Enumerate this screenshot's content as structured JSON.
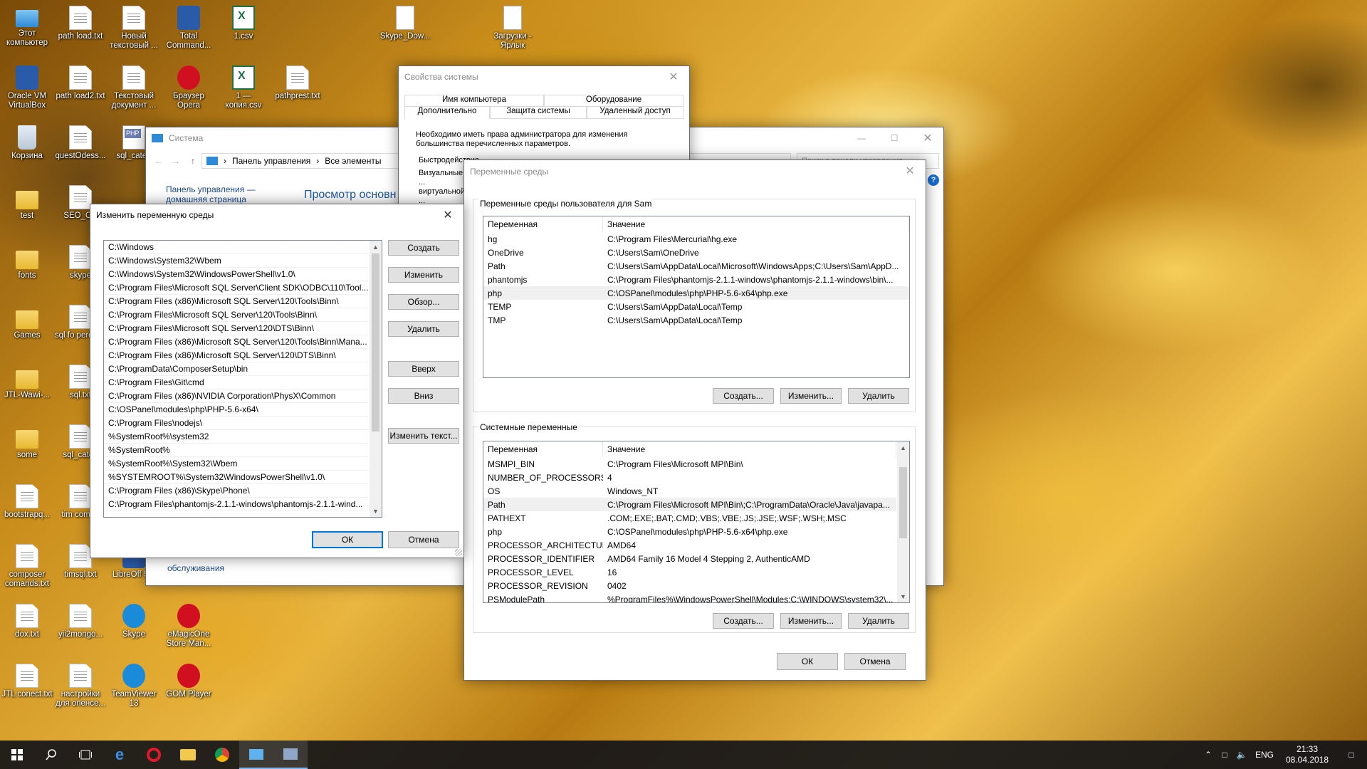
{
  "desktop": {
    "icons": [
      {
        "label": "Этот компьютер",
        "icon": "computer-icon"
      },
      {
        "label": "path load.txt",
        "icon": "text-file-icon"
      },
      {
        "label": "Новый текстовый ...",
        "icon": "text-file-icon"
      },
      {
        "label": "Total Command...",
        "icon": "total-commander-icon"
      },
      {
        "label": "1.csv",
        "icon": "csv-file-icon"
      },
      {
        "label": "Skype_Dow...",
        "icon": "shortcut-icon"
      },
      {
        "label": "Загрузки - Ярлык",
        "icon": "shortcut-icon"
      },
      {
        "label": "Oracle VM VirtualBox",
        "icon": "virtualbox-icon"
      },
      {
        "label": "path load2.txt",
        "icon": "text-file-icon"
      },
      {
        "label": "Текстовый документ ...",
        "icon": "text-file-icon"
      },
      {
        "label": "Браузер Opera",
        "icon": "opera-icon"
      },
      {
        "label": "1 — копия.csv",
        "icon": "csv-file-icon"
      },
      {
        "label": "pathprest.txt",
        "icon": "text-file-icon"
      },
      {
        "label": "Корзина",
        "icon": "recycle-bin-icon"
      },
      {
        "label": "questOdess...",
        "icon": "text-file-icon"
      },
      {
        "label": "sql_categ",
        "icon": "php-file-icon"
      },
      {
        "label": "test",
        "icon": "folder-icon"
      },
      {
        "label": "SEO_OP",
        "icon": "text-file-icon"
      },
      {
        "label": "fonts",
        "icon": "folder-icon"
      },
      {
        "label": "skype",
        "icon": "text-file-icon"
      },
      {
        "label": "Games",
        "icon": "folder-icon"
      },
      {
        "label": "sql fo perenos",
        "icon": "text-file-icon"
      },
      {
        "label": "JTL-Wawi-...",
        "icon": "folder-icon"
      },
      {
        "label": "sql.txt",
        "icon": "text-file-icon"
      },
      {
        "label": "some",
        "icon": "folder-icon"
      },
      {
        "label": "sql_categ",
        "icon": "text-file-icon"
      },
      {
        "label": "bootstrapq...",
        "icon": "text-file-icon"
      },
      {
        "label": "tim compo",
        "icon": "text-file-icon"
      },
      {
        "label": "composer comands.txt",
        "icon": "text-file-icon"
      },
      {
        "label": "timsql.txt",
        "icon": "text-file-icon"
      },
      {
        "label": "LibreOff 5.4",
        "icon": "libreoffice-icon"
      },
      {
        "label": "dox.txt",
        "icon": "text-file-icon"
      },
      {
        "label": "yii2mongo...",
        "icon": "text-file-icon"
      },
      {
        "label": "Skype",
        "icon": "skype-icon"
      },
      {
        "label": "eMagicOne Store Man...",
        "icon": "emagicone-icon"
      },
      {
        "label": "JTL conect.txt",
        "icon": "text-file-icon"
      },
      {
        "label": "настройки для опенсе...",
        "icon": "text-file-icon"
      },
      {
        "label": "TeamViewer 13",
        "icon": "teamviewer-icon"
      },
      {
        "label": "GOM Player",
        "icon": "gom-player-icon"
      }
    ]
  },
  "system_window": {
    "title": "Система",
    "breadcrumb": [
      "Панель управления",
      "Все элементы"
    ],
    "sidebar_link": "Панель управления — домашняя страница",
    "heading": "Просмотр основн",
    "footer_link": "обслуживания",
    "search_placeholder": "Поиск в панели управления"
  },
  "sysprops_window": {
    "title": "Свойства системы",
    "tabs_row1": [
      "Имя компьютера",
      "Оборудование"
    ],
    "tabs_row2": [
      "Дополнительно",
      "Защита системы",
      "Удаленный доступ"
    ],
    "admin_note": "Необходимо иметь права администратора для изменения большинства перечисленных параметров.",
    "perf_label": "Быстродействие",
    "perf_desc": "Визуальные ... виртуальной ..."
  },
  "env_window": {
    "title": "Переменные среды",
    "user_group_label": "Переменные среды пользователя для Sam",
    "columns": [
      "Переменная",
      "Значение"
    ],
    "user_vars": [
      {
        "name": "hg",
        "value": "C:\\Program Files\\Mercurial\\hg.exe"
      },
      {
        "name": "OneDrive",
        "value": "C:\\Users\\Sam\\OneDrive"
      },
      {
        "name": "Path",
        "value": "C:\\Users\\Sam\\AppData\\Local\\Microsoft\\WindowsApps;C:\\Users\\Sam\\AppD..."
      },
      {
        "name": "phantomjs",
        "value": "C:\\Program Files\\phantomjs-2.1.1-windows\\phantomjs-2.1.1-windows\\bin\\..."
      },
      {
        "name": "php",
        "value": "C:\\OSPanel\\modules\\php\\PHP-5.6-x64\\php.exe"
      },
      {
        "name": "TEMP",
        "value": "C:\\Users\\Sam\\AppData\\Local\\Temp"
      },
      {
        "name": "TMP",
        "value": "C:\\Users\\Sam\\AppData\\Local\\Temp"
      }
    ],
    "user_selected_index": 4,
    "system_group_label": "Системные переменные",
    "system_vars": [
      {
        "name": "MSMPI_BIN",
        "value": "C:\\Program Files\\Microsoft MPI\\Bin\\"
      },
      {
        "name": "NUMBER_OF_PROCESSORS",
        "value": "4"
      },
      {
        "name": "OS",
        "value": "Windows_NT"
      },
      {
        "name": "Path",
        "value": "C:\\Program Files\\Microsoft MPI\\Bin\\;C:\\ProgramData\\Oracle\\Java\\javapa..."
      },
      {
        "name": "PATHEXT",
        "value": ".COM;.EXE;.BAT;.CMD;.VBS;.VBE;.JS;.JSE;.WSF;.WSH;.MSC"
      },
      {
        "name": "php",
        "value": "C:\\OSPanel\\modules\\php\\PHP-5.6-x64\\php.exe"
      },
      {
        "name": "PROCESSOR_ARCHITECTURE",
        "value": "AMD64"
      },
      {
        "name": "PROCESSOR_IDENTIFIER",
        "value": "AMD64 Family 16 Model 4 Stepping 2, AuthenticAMD"
      },
      {
        "name": "PROCESSOR_LEVEL",
        "value": "16"
      },
      {
        "name": "PROCESSOR_REVISION",
        "value": "0402"
      },
      {
        "name": "PSModulePath",
        "value": "%ProgramFiles%\\WindowsPowerShell\\Modules;C:\\WINDOWS\\system32\\..."
      }
    ],
    "system_selected_index": 3,
    "btn_create": "Создать...",
    "btn_edit": "Изменить...",
    "btn_delete": "Удалить",
    "btn_ok": "ОК",
    "btn_cancel": "Отмена"
  },
  "edit_window": {
    "title": "Изменить переменную среды",
    "paths": [
      "C:\\Windows",
      "C:\\Windows\\System32\\Wbem",
      "C:\\Windows\\System32\\WindowsPowerShell\\v1.0\\",
      "C:\\Program Files\\Microsoft SQL Server\\Client SDK\\ODBC\\110\\Tool...",
      "C:\\Program Files (x86)\\Microsoft SQL Server\\120\\Tools\\Binn\\",
      "C:\\Program Files\\Microsoft SQL Server\\120\\Tools\\Binn\\",
      "C:\\Program Files\\Microsoft SQL Server\\120\\DTS\\Binn\\",
      "C:\\Program Files (x86)\\Microsoft SQL Server\\120\\Tools\\Binn\\Mana...",
      "C:\\Program Files (x86)\\Microsoft SQL Server\\120\\DTS\\Binn\\",
      "C:\\ProgramData\\ComposerSetup\\bin",
      "C:\\Program Files\\Git\\cmd",
      "C:\\Program Files (x86)\\NVIDIA Corporation\\PhysX\\Common",
      "C:\\OSPanel\\modules\\php\\PHP-5.6-x64\\",
      "C:\\Program Files\\nodejs\\",
      "%SystemRoot%\\system32",
      "%SystemRoot%",
      "%SystemRoot%\\System32\\Wbem",
      "%SYSTEMROOT%\\System32\\WindowsPowerShell\\v1.0\\",
      "C:\\Program Files (x86)\\Skype\\Phone\\",
      "C:\\Program Files\\phantomjs-2.1.1-windows\\phantomjs-2.1.1-wind..."
    ],
    "btn_create": "Создать",
    "btn_edit": "Изменить",
    "btn_browse": "Обзор...",
    "btn_delete": "Удалить",
    "btn_up": "Вверх",
    "btn_down": "Вниз",
    "btn_edit_text": "Изменить текст...",
    "btn_ok": "ОК",
    "btn_cancel": "Отмена"
  },
  "taskbar": {
    "language": "ENG",
    "time": "21:33",
    "date": "08.04.2018"
  }
}
